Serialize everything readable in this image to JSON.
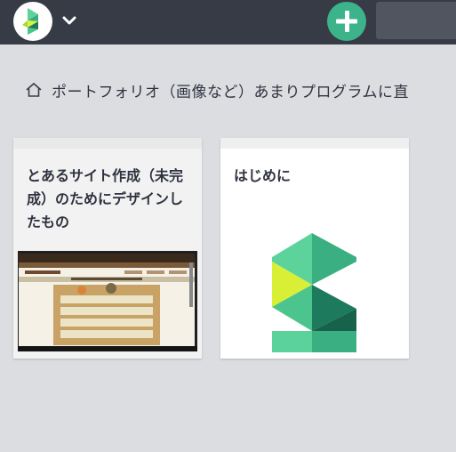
{
  "header": {
    "logo_icon": "app-logo-icon",
    "menu_icon": "chevron-down-icon",
    "add_icon": "plus-icon",
    "colors": {
      "bar": "#363b46",
      "accent": "#3cb38a"
    }
  },
  "breadcrumb": {
    "icon": "home-icon",
    "text": "ポートフォリオ（画像など）あまりプログラムに直"
  },
  "cards": [
    {
      "title": "とあるサイト作成（未完成）のためにデザインしたもの",
      "thumbnail": "website-screenshot"
    },
    {
      "title": "はじめに",
      "thumbnail": "app-logo"
    }
  ]
}
